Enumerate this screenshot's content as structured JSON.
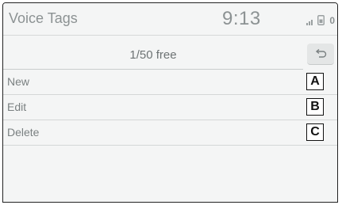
{
  "status_bar": {
    "title": "Voice Tags",
    "time": "9:13",
    "icons": [
      "signal-icon",
      "phone-icon"
    ],
    "count": "0"
  },
  "header": {
    "free_count": "1/50 free",
    "back_icon": "return-arrow-icon"
  },
  "menu": {
    "items": [
      {
        "label": "New",
        "callout": "A"
      },
      {
        "label": "Edit",
        "callout": "B"
      },
      {
        "label": "Delete",
        "callout": "C"
      }
    ]
  },
  "colors": {
    "background": "#f4f5f5",
    "text": "#8c9293",
    "divider": "#d4d7d7"
  }
}
